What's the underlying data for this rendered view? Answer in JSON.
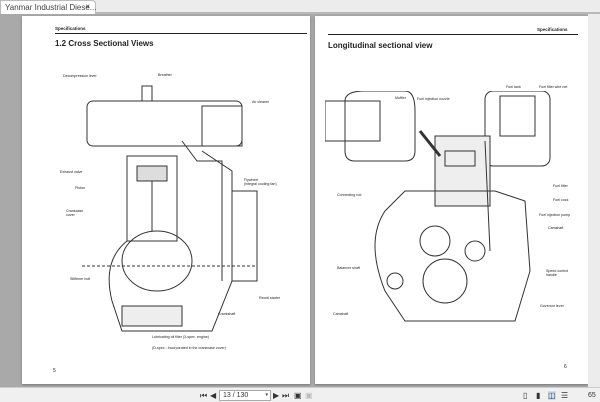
{
  "tab": {
    "title": "Yanmar Industrial Diese...",
    "close": "×"
  },
  "left_page": {
    "header": "Specifications",
    "title": "1.2  Cross Sectional Views",
    "page_number": "5",
    "labels": [
      "Decompression lever",
      "Breather",
      "Air cleaner",
      "Exhaust valve",
      "Piston",
      "Flywheel\n(integral cooling fan)",
      "Crankcase cover",
      "Stiffener bolt",
      "Recoil starter",
      "Crankshaft",
      "Lubricating oil filter (3-spec. engine)",
      "(D-spec.: Incorporated in the crankcase cover)"
    ]
  },
  "right_page": {
    "header": "Specifications",
    "title": "Longitudinal sectional view",
    "page_number": "6",
    "labels": [
      "Muffler",
      "Fuel injection nozzle",
      "Fuel tank",
      "Fuel filter wire net",
      "Fuel filter",
      "Fuel cock",
      "Fuel injection pump",
      "Camshaft",
      "Connecting rod",
      "Balancer shaft",
      "Camshaft",
      "Speed control handle",
      "Governor lever"
    ]
  },
  "toolbar": {
    "first": "⏮",
    "prev": "◀",
    "page_value": "13 / 130",
    "dropdown": "▾",
    "next": "▶",
    "last": "⏭",
    "zoom": "65"
  }
}
